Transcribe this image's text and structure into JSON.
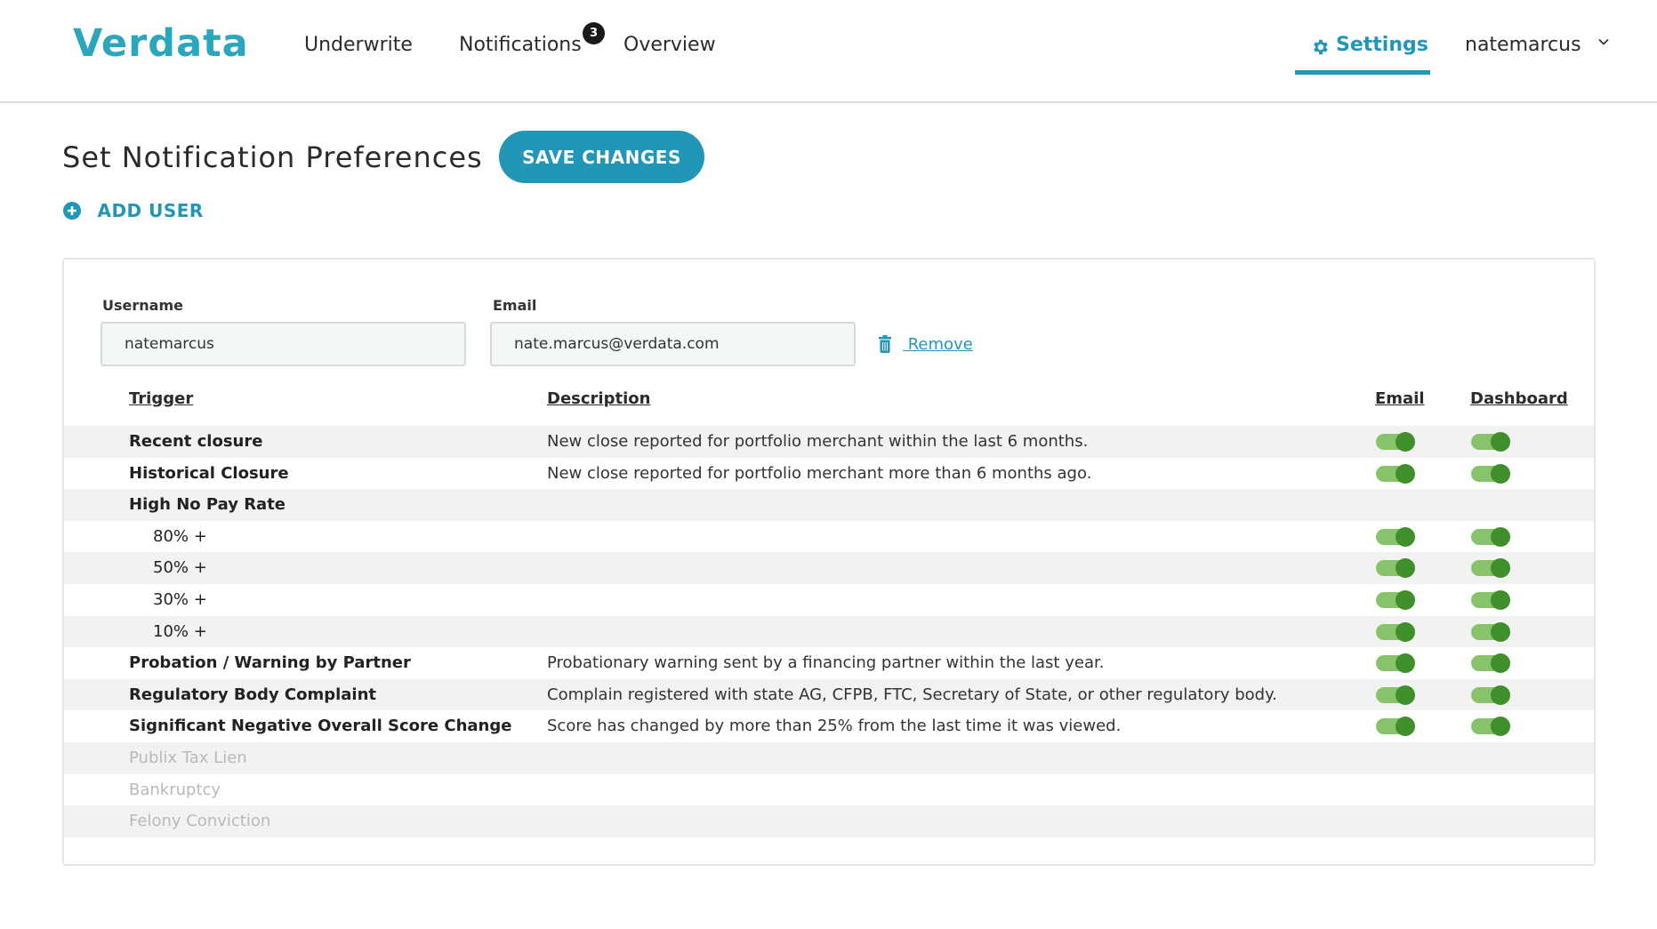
{
  "header": {
    "logo": "Verdata",
    "nav": [
      {
        "label": "Underwrite"
      },
      {
        "label": "Notifications",
        "badge": "3"
      },
      {
        "label": "Overview"
      }
    ],
    "settings_label": "Settings",
    "user": "natemarcus"
  },
  "page": {
    "title": "Set Notification Preferences",
    "save_label": "SAVE CHANGES",
    "add_user_label": "ADD USER"
  },
  "user_card": {
    "username_label": "Username",
    "username_value": "natemarcus",
    "email_label": "Email",
    "email_value": "nate.marcus@verdata.com",
    "remove_label": "Remove",
    "columns": {
      "trigger": "Trigger",
      "description": "Description",
      "email": "Email",
      "dashboard": "Dashboard"
    },
    "rows": [
      {
        "trigger": "Recent closure",
        "description": "New close reported for portfolio merchant within the last 6 months.",
        "email_on": true,
        "dashboard_on": true
      },
      {
        "trigger": "Historical Closure",
        "description": "New close reported for portfolio merchant more than 6 months ago.",
        "email_on": true,
        "dashboard_on": true
      },
      {
        "trigger": "High No Pay Rate",
        "description": ""
      },
      {
        "trigger": "80% +",
        "description": "",
        "email_on": true,
        "dashboard_on": true
      },
      {
        "trigger": "50% +",
        "description": "",
        "email_on": true,
        "dashboard_on": true
      },
      {
        "trigger": "30% +",
        "description": "",
        "email_on": true,
        "dashboard_on": true
      },
      {
        "trigger": "10% +",
        "description": "",
        "email_on": true,
        "dashboard_on": true
      },
      {
        "trigger": "Probation / Warning by Partner",
        "description": "Probationary warning sent by a financing partner within the last year.",
        "email_on": true,
        "dashboard_on": true
      },
      {
        "trigger": "Regulatory Body Complaint",
        "description": "Complain registered with state AG, CFPB, FTC, Secretary of State, or other regulatory body.",
        "email_on": true,
        "dashboard_on": true
      },
      {
        "trigger": "Significant Negative Overall Score Change",
        "description": "Score has changed by more than 25% from the last time it was viewed.",
        "email_on": true,
        "dashboard_on": true
      },
      {
        "trigger": "Publix Tax Lien",
        "description": ""
      },
      {
        "trigger": "Bankruptcy",
        "description": ""
      },
      {
        "trigger": "Felony Conviction",
        "description": ""
      }
    ]
  },
  "colors": {
    "brand": "#2aa7bd",
    "accent": "#2296b6",
    "toggle_track": "#86c36a",
    "toggle_knob": "#3f8f2a"
  },
  "icons": [
    "gear-icon",
    "chevron-down-icon",
    "plus-circle-icon",
    "trash-icon"
  ]
}
